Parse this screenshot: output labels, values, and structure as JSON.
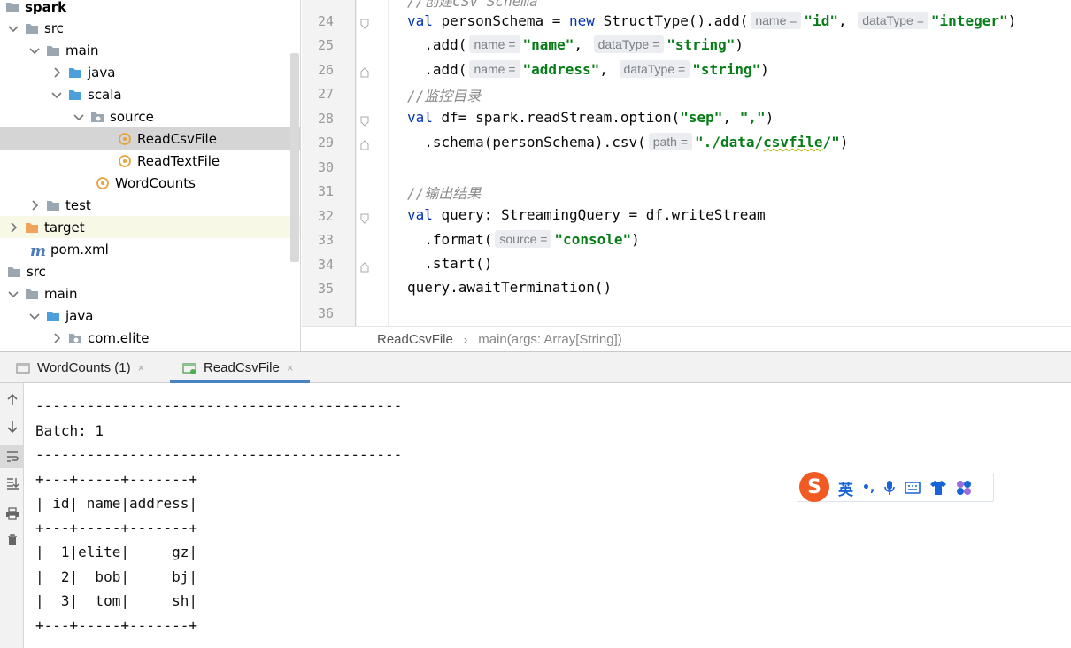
{
  "tree": {
    "items": [
      {
        "label": "spark",
        "bold": true
      },
      {
        "label": "src"
      },
      {
        "label": "main"
      },
      {
        "label": "java"
      },
      {
        "label": "scala"
      },
      {
        "label": "source"
      },
      {
        "label": "ReadCsvFile"
      },
      {
        "label": "ReadTextFile"
      },
      {
        "label": "WordCounts"
      },
      {
        "label": "test"
      },
      {
        "label": "target"
      },
      {
        "label": "pom.xml"
      },
      {
        "label": "src"
      },
      {
        "label": "main"
      },
      {
        "label": "java"
      },
      {
        "label": "com.elite"
      }
    ]
  },
  "editor": {
    "line_numbers": [
      "24",
      "25",
      "26",
      "27",
      "28",
      "29",
      "30",
      "31",
      "32",
      "33",
      "34",
      "35",
      "36"
    ],
    "top_partial": "//创建CSV Schema",
    "lines": {
      "l24": {
        "kw": "val",
        "t1": " personSchema = ",
        "kw2": "new",
        "t2": " StructType().add(",
        "h1": "name =",
        "s1": "\"id\"",
        "t3": ",",
        "h2": "dataType =",
        "s2": "\"integer\"",
        "t4": ")"
      },
      "l25": {
        "t1": "  .add(",
        "h1": "name =",
        "s1": "\"name\"",
        "t2": ",",
        "h2": "dataType =",
        "s2": "\"string\"",
        "t3": ")"
      },
      "l26": {
        "t1": "  .add(",
        "h1": "name =",
        "s1": "\"address\"",
        "t2": ",",
        "h2": "dataType =",
        "s2": "\"string\"",
        "t3": ")"
      },
      "l27": {
        "c": "//监控目录"
      },
      "l28": {
        "kw": "val",
        "t1": " df= spark.readStream.option(",
        "s1": "\"sep\"",
        "t2": ", ",
        "s2": "\",\"",
        "t3": ")"
      },
      "l29": {
        "t1": "  .schema(personSchema).csv(",
        "h1": "path =",
        "s1a": "\"./data/",
        "s1b": "csvfile",
        "s1c": "/\"",
        "t2": ")"
      },
      "l31": {
        "c": "//输出结果"
      },
      "l32": {
        "kw": "val",
        "t1": " query: StreamingQuery = df.writeStream"
      },
      "l33": {
        "t1": "  .format(",
        "h1": "source =",
        "s1": "\"console\"",
        "t2": ")"
      },
      "l34": {
        "t1": "  .start()"
      },
      "l35": {
        "t1": "query.awaitTermination()"
      }
    }
  },
  "breadcrumb": {
    "file": "ReadCsvFile",
    "sep": "›",
    "method": "main(args: Array[String])"
  },
  "run_tabs": [
    {
      "label": "WordCounts (1)",
      "close": "×"
    },
    {
      "label": "ReadCsvFile",
      "close": "×"
    }
  ],
  "console": {
    "lines": [
      "-------------------------------------------",
      "Batch: 1",
      "-------------------------------------------",
      "+---+-----+-------+",
      "| id| name|address|",
      "+---+-----+-------+",
      "|  1|elite|     gz|",
      "|  2|  bob|     bj|",
      "|  3|  tom|     sh|",
      "+---+-----+-------+"
    ]
  },
  "ime": {
    "logo": "S",
    "lang": "英",
    "punct": "•,"
  },
  "colors": {
    "keyword": "#0033b3",
    "string": "#067d17",
    "comment": "#8c8c8c",
    "folder": "#87adcf",
    "source_folder": "#4d9fdb",
    "excluded_folder": "#f0a35a",
    "scala_obj": "#e8a33d",
    "tab_underline": "#4a83c4"
  }
}
